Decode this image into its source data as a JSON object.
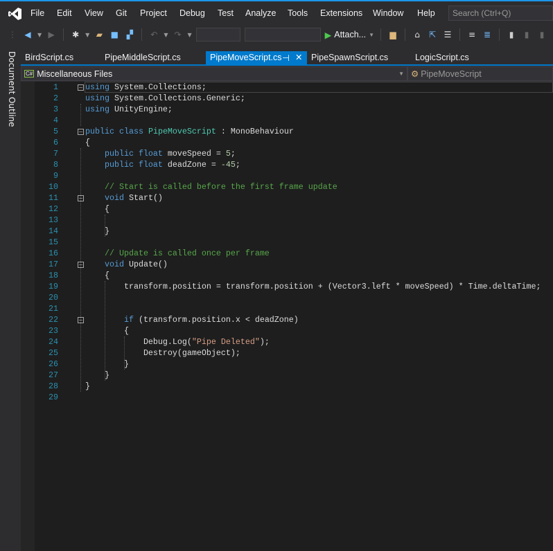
{
  "menu": [
    "File",
    "Edit",
    "View",
    "Git",
    "Project",
    "Debug",
    "Test",
    "Analyze",
    "Tools",
    "Extensions",
    "Window",
    "Help"
  ],
  "search_placeholder": "Search (Ctrl+Q)",
  "toolbar": {
    "attach_label": "Attach..."
  },
  "side_panel": "Document Outline",
  "tabs": [
    {
      "label": "BirdScript.cs",
      "active": false
    },
    {
      "label": "PipeMiddleScript.cs",
      "active": false
    },
    {
      "label": "PipeMoveScript.cs",
      "active": true
    },
    {
      "label": "PipeSpawnScript.cs",
      "active": false
    },
    {
      "label": "LogicScript.cs",
      "active": false
    }
  ],
  "navbar": {
    "project": "Miscellaneous Files",
    "project_icon": "C#",
    "member": "PipeMoveScript"
  },
  "code": [
    {
      "n": "1",
      "fold": true,
      "t": [
        [
          "kw",
          "using"
        ],
        [
          "",
          "System.Collections;"
        ]
      ]
    },
    {
      "n": "2",
      "t": [
        [
          "kw",
          "using"
        ],
        [
          "",
          "System.Collections.Generic;"
        ]
      ]
    },
    {
      "n": "3",
      "t": [
        [
          "kw",
          "using"
        ],
        [
          "",
          "UnityEngine;"
        ]
      ]
    },
    {
      "n": "4",
      "t": []
    },
    {
      "n": "5",
      "fold": true,
      "t": [
        [
          "kw",
          "public class"
        ],
        [
          "cls",
          "PipeMoveScript"
        ],
        [
          "",
          " : MonoBehaviour"
        ]
      ]
    },
    {
      "n": "6",
      "t": [
        [
          "",
          "{"
        ]
      ]
    },
    {
      "n": "7",
      "t": [
        [
          "kw",
          "    public float"
        ],
        [
          "",
          " moveSpeed = "
        ],
        [
          "num",
          "5"
        ],
        [
          "",
          ";"
        ]
      ]
    },
    {
      "n": "8",
      "t": [
        [
          "kw",
          "    public float"
        ],
        [
          "",
          " deadZone = "
        ],
        [
          "num",
          "-45"
        ],
        [
          "",
          ";"
        ]
      ]
    },
    {
      "n": "9",
      "t": []
    },
    {
      "n": "10",
      "t": [
        [
          "cm",
          "    // Start is called before the first frame update"
        ]
      ]
    },
    {
      "n": "11",
      "fold": true,
      "t": [
        [
          "kw",
          "    void"
        ],
        [
          "",
          " Start()"
        ]
      ]
    },
    {
      "n": "12",
      "t": [
        [
          "",
          "    {"
        ]
      ]
    },
    {
      "n": "13",
      "t": []
    },
    {
      "n": "14",
      "t": [
        [
          "",
          "    }"
        ]
      ]
    },
    {
      "n": "15",
      "t": []
    },
    {
      "n": "16",
      "t": [
        [
          "cm",
          "    // Update is called once per frame"
        ]
      ]
    },
    {
      "n": "17",
      "fold": true,
      "t": [
        [
          "kw",
          "    void"
        ],
        [
          "",
          " Update()"
        ]
      ]
    },
    {
      "n": "18",
      "t": [
        [
          "",
          "    {"
        ]
      ]
    },
    {
      "n": "19",
      "t": [
        [
          "",
          "        transform.position = transform.position + (Vector3.left * moveSpeed) * Time.deltaTime;"
        ]
      ]
    },
    {
      "n": "20",
      "t": []
    },
    {
      "n": "21",
      "t": []
    },
    {
      "n": "22",
      "fold": true,
      "t": [
        [
          "kw",
          "        if"
        ],
        [
          "",
          " (transform.position.x < deadZone)"
        ]
      ]
    },
    {
      "n": "23",
      "t": [
        [
          "",
          "        {"
        ]
      ]
    },
    {
      "n": "24",
      "t": [
        [
          "",
          "            Debug.Log("
        ],
        [
          "str",
          "\"Pipe Deleted\""
        ],
        [
          "",
          ");"
        ]
      ]
    },
    {
      "n": "25",
      "t": [
        [
          "",
          "            Destroy(gameObject);"
        ]
      ]
    },
    {
      "n": "26",
      "t": [
        [
          "",
          "        }"
        ]
      ]
    },
    {
      "n": "27",
      "t": [
        [
          "",
          "    }"
        ]
      ]
    },
    {
      "n": "28",
      "t": [
        [
          "",
          "}"
        ]
      ]
    },
    {
      "n": "29",
      "t": []
    }
  ]
}
